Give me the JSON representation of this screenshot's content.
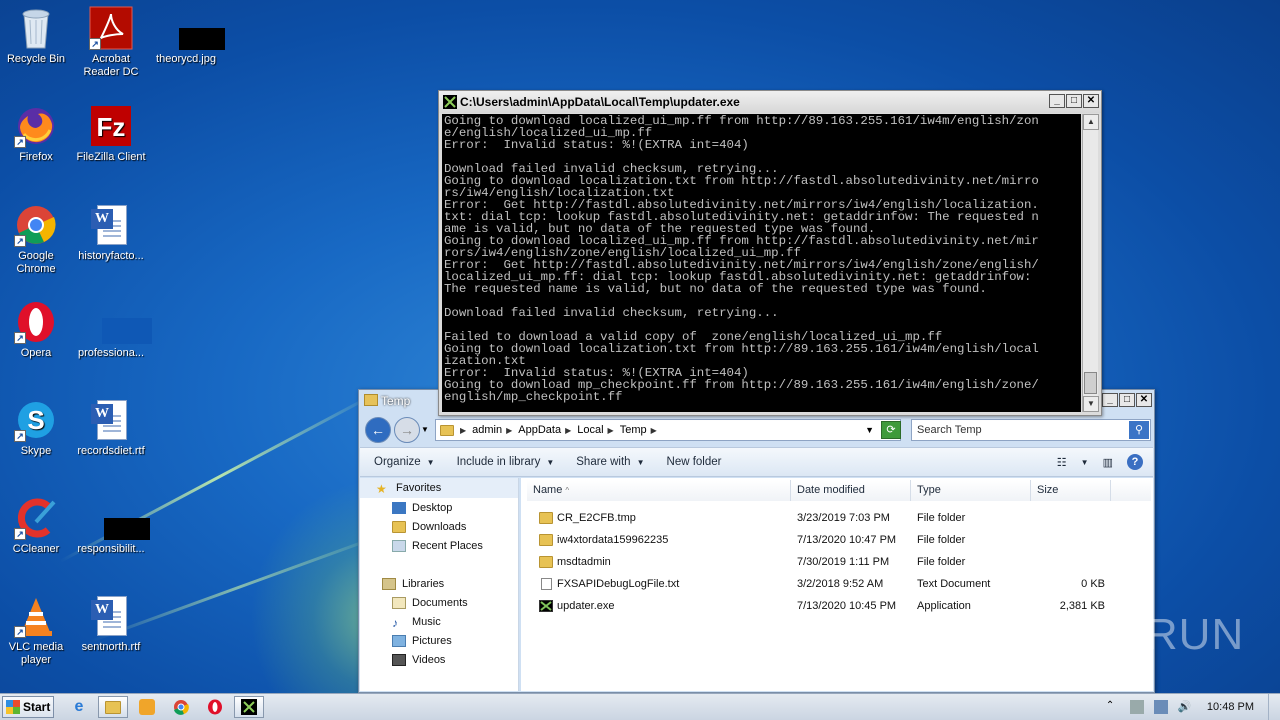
{
  "desktop": {
    "icons": [
      {
        "label": "Recycle Bin"
      },
      {
        "label": "Acrobat Reader DC"
      },
      {
        "label": "theorycd.jpg"
      },
      {
        "label": "Firefox"
      },
      {
        "label": "FileZilla Client"
      },
      {
        "label": "Google Chrome"
      },
      {
        "label": "historyfacto..."
      },
      {
        "label": "Opera"
      },
      {
        "label": "professiona..."
      },
      {
        "label": "Skype"
      },
      {
        "label": "recordsdiet.rtf"
      },
      {
        "label": "CCleaner"
      },
      {
        "label": "responsibilit..."
      },
      {
        "label": "VLC media player"
      },
      {
        "label": "sentnorth.rtf"
      }
    ]
  },
  "console": {
    "title": "C:\\Users\\admin\\AppData\\Local\\Temp\\updater.exe",
    "output": "Going to download localized_ui_mp.ff from http://89.163.255.161/iw4m/english/zon\ne/english/localized_ui_mp.ff\nError:  Invalid status: %!(EXTRA int=404)\n\nDownload failed invalid checksum, retrying...\nGoing to download localization.txt from http://fastdl.absolutedivinity.net/mirro\nrs/iw4/english/localization.txt\nError:  Get http://fastdl.absolutedivinity.net/mirrors/iw4/english/localization.\ntxt: dial tcp: lookup fastdl.absolutedivinity.net: getaddrinfow: The requested n\name is valid, but no data of the requested type was found.\nGoing to download localized_ui_mp.ff from http://fastdl.absolutedivinity.net/mir\nrors/iw4/english/zone/english/localized_ui_mp.ff\nError:  Get http://fastdl.absolutedivinity.net/mirrors/iw4/english/zone/english/\nlocalized_ui_mp.ff: dial tcp: lookup fastdl.absolutedivinity.net: getaddrinfow:\nThe requested name is valid, but no data of the requested type was found.\n\nDownload failed invalid checksum, retrying...\n\nFailed to download a valid copy of  zone/english/localized_ui_mp.ff\nGoing to download localization.txt from http://89.163.255.161/iw4m/english/local\nization.txt\nError:  Invalid status: %!(EXTRA int=404)\nGoing to download mp_checkpoint.ff from http://89.163.255.161/iw4m/english/zone/\nenglish/mp_checkpoint.ff"
  },
  "explorer": {
    "title": "Temp",
    "breadcrumb": [
      "admin",
      "AppData",
      "Local",
      "Temp"
    ],
    "search_placeholder": "Search Temp",
    "toolbar": {
      "organize": "Organize",
      "include": "Include in library",
      "share": "Share with",
      "new_folder": "New folder"
    },
    "nav": {
      "favorites": "Favorites",
      "desktop": "Desktop",
      "downloads": "Downloads",
      "recent": "Recent Places",
      "libraries": "Libraries",
      "documents": "Documents",
      "music": "Music",
      "pictures": "Pictures",
      "videos": "Videos"
    },
    "columns": {
      "name": "Name",
      "date": "Date modified",
      "type": "Type",
      "size": "Size"
    },
    "files": [
      {
        "name": "CR_E2CFB.tmp",
        "date": "3/23/2019 7:03 PM",
        "type": "File folder",
        "size": ""
      },
      {
        "name": "iw4xtordata159962235",
        "date": "7/13/2020 10:47 PM",
        "type": "File folder",
        "size": ""
      },
      {
        "name": "msdtadmin",
        "date": "7/30/2019 1:11 PM",
        "type": "File folder",
        "size": ""
      },
      {
        "name": "FXSAPIDebugLogFile.txt",
        "date": "3/2/2018 9:52 AM",
        "type": "Text Document",
        "size": "0 KB"
      },
      {
        "name": "updater.exe",
        "date": "7/13/2020 10:45 PM",
        "type": "Application",
        "size": "2,381 KB"
      }
    ]
  },
  "watermark": "ANY RUN",
  "taskbar": {
    "start_label": "Start",
    "clock": "10:48 PM"
  },
  "colors": {
    "console_bg": "#000000",
    "console_text": "#c0c0c0",
    "desktop": "#1869c4"
  }
}
